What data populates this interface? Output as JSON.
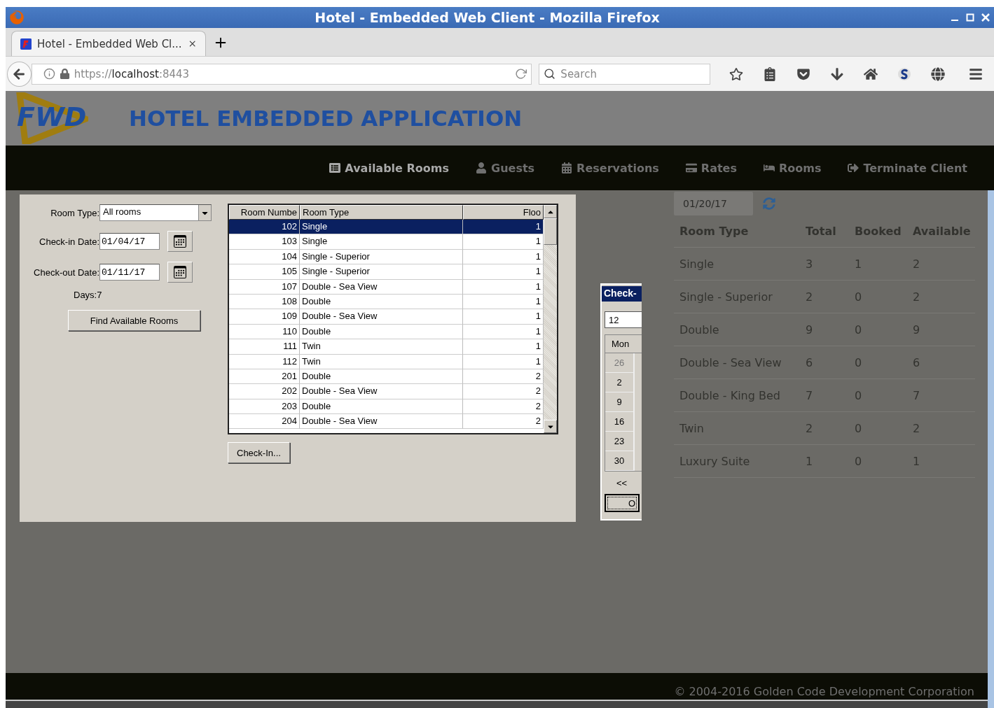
{
  "window": {
    "title": "Hotel - Embedded Web Client - Mozilla Firefox"
  },
  "browser": {
    "tabs": [
      {
        "label": "Hotel - Embedded Web Cl...",
        "selected": true
      }
    ],
    "url": {
      "scheme": "https://",
      "host": "localhost",
      "port": ":8443"
    },
    "search": {
      "placeholder": "Search"
    }
  },
  "app": {
    "logo": "FWD",
    "title": "HOTEL EMBEDDED APPLICATION",
    "nav": [
      {
        "label": "Available Rooms",
        "selected": true
      },
      {
        "label": "Guests",
        "selected": false
      },
      {
        "label": "Reservations",
        "selected": false
      },
      {
        "label": "Rates",
        "selected": false
      },
      {
        "label": "Rooms",
        "selected": false
      },
      {
        "label": "Terminate Client",
        "selected": false
      }
    ]
  },
  "form": {
    "room_type": {
      "label": "Room Type:",
      "value": "All rooms"
    },
    "check_in": {
      "label": "Check-in Date:",
      "value": "01/04/17"
    },
    "check_out": {
      "label": "Check-out Date:",
      "value": "01/11/17"
    },
    "days": "Days:7",
    "find_button": "Find Available Rooms"
  },
  "rooms_table": {
    "columns": [
      "Room Numbe",
      "Room Type",
      "Floo"
    ],
    "rows": [
      {
        "number": "102",
        "type": "Single",
        "floor": "1",
        "selected": true
      },
      {
        "number": "103",
        "type": "Single",
        "floor": "1",
        "selected": false
      },
      {
        "number": "104",
        "type": "Single - Superior",
        "floor": "1",
        "selected": false
      },
      {
        "number": "105",
        "type": "Single - Superior",
        "floor": "1",
        "selected": false
      },
      {
        "number": "107",
        "type": "Double - Sea View",
        "floor": "1",
        "selected": false
      },
      {
        "number": "108",
        "type": "Double",
        "floor": "1",
        "selected": false
      },
      {
        "number": "109",
        "type": "Double - Sea View",
        "floor": "1",
        "selected": false
      },
      {
        "number": "110",
        "type": "Double",
        "floor": "1",
        "selected": false
      },
      {
        "number": "111",
        "type": "Twin",
        "floor": "1",
        "selected": false
      },
      {
        "number": "112",
        "type": "Twin",
        "floor": "1",
        "selected": false
      },
      {
        "number": "201",
        "type": "Double",
        "floor": "2",
        "selected": false
      },
      {
        "number": "202",
        "type": "Double - Sea View",
        "floor": "2",
        "selected": false
      },
      {
        "number": "203",
        "type": "Double",
        "floor": "2",
        "selected": false
      },
      {
        "number": "204",
        "type": "Double - Sea View",
        "floor": "2",
        "selected": false
      }
    ]
  },
  "check_in_button": "Check-In...",
  "calendar_dialog": {
    "title": "Check-",
    "field": "12",
    "column": "Mon",
    "days": [
      {
        "label": "26",
        "disabled": true
      },
      {
        "label": "2",
        "disabled": false
      },
      {
        "label": "9",
        "disabled": false
      },
      {
        "label": "16",
        "disabled": false
      },
      {
        "label": "23",
        "disabled": false
      },
      {
        "label": "30",
        "disabled": false
      }
    ],
    "prev": "<<",
    "button": "O"
  },
  "availability": {
    "date": "01/20/17",
    "columns": [
      "Room Type",
      "Total",
      "Booked",
      "Available"
    ],
    "rows": [
      [
        "Single",
        "3",
        "1",
        "2"
      ],
      [
        "Single - Superior",
        "2",
        "0",
        "2"
      ],
      [
        "Double",
        "9",
        "0",
        "9"
      ],
      [
        "Double - Sea View",
        "6",
        "0",
        "6"
      ],
      [
        "Double - King Bed",
        "7",
        "0",
        "7"
      ],
      [
        "Twin",
        "2",
        "0",
        "2"
      ],
      [
        "Luxury Suite",
        "1",
        "0",
        "1"
      ]
    ]
  },
  "footer": "© 2004-2016 Golden Code Development Corporation"
}
